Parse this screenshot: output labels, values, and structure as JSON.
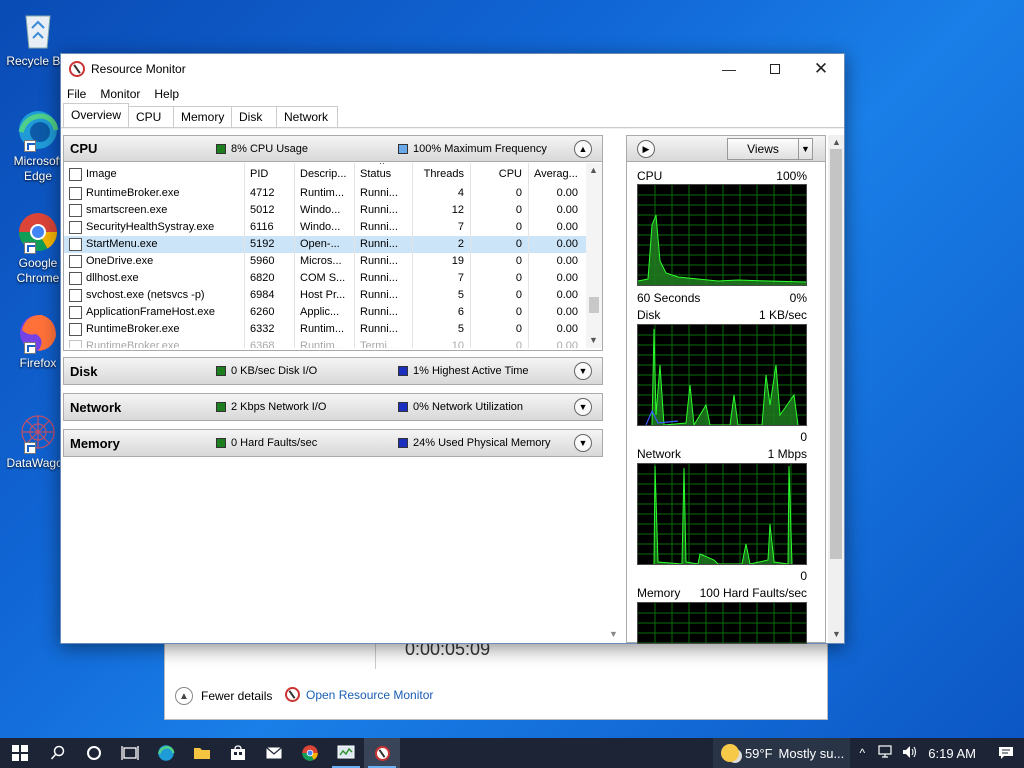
{
  "desktop": {
    "icons": [
      {
        "label": "Recycle Bin",
        "icon": "recycle-bin-icon"
      },
      {
        "label": "Microsoft Edge",
        "icon": "edge-icon"
      },
      {
        "label": "Google Chrome",
        "icon": "chrome-icon"
      },
      {
        "label": "Firefox",
        "icon": "firefox-icon"
      },
      {
        "label": "DataWagon",
        "icon": "datawagon-icon"
      }
    ]
  },
  "taskmgr": {
    "digits": "0:00:05:09",
    "fewer_details": "Fewer details",
    "open_resource_monitor": "Open Resource Monitor"
  },
  "window": {
    "title": "Resource Monitor",
    "menu": [
      "File",
      "Monitor",
      "Help"
    ],
    "tabs": [
      "Overview",
      "CPU",
      "Memory",
      "Disk",
      "Network"
    ],
    "active_tab": "Overview"
  },
  "cpu": {
    "title": "CPU",
    "usage": "8% CPU Usage",
    "frequency": "100% Maximum Frequency",
    "columns": [
      "Image",
      "PID",
      "Descrip...",
      "Status",
      "Threads",
      "CPU",
      "Averag..."
    ],
    "rows": [
      {
        "image": "RuntimeBroker.exe",
        "pid": "4712",
        "desc": "Runtim...",
        "status": "Runni...",
        "threads": "4",
        "cpu": "0",
        "avg": "0.00"
      },
      {
        "image": "smartscreen.exe",
        "pid": "5012",
        "desc": "Windo...",
        "status": "Runni...",
        "threads": "12",
        "cpu": "0",
        "avg": "0.00"
      },
      {
        "image": "SecurityHealthSystray.exe",
        "pid": "6116",
        "desc": "Windo...",
        "status": "Runni...",
        "threads": "7",
        "cpu": "0",
        "avg": "0.00"
      },
      {
        "image": "StartMenu.exe",
        "pid": "5192",
        "desc": "Open-...",
        "status": "Runni...",
        "threads": "2",
        "cpu": "0",
        "avg": "0.00"
      },
      {
        "image": "OneDrive.exe",
        "pid": "5960",
        "desc": "Micros...",
        "status": "Runni...",
        "threads": "19",
        "cpu": "0",
        "avg": "0.00"
      },
      {
        "image": "dllhost.exe",
        "pid": "6820",
        "desc": "COM S...",
        "status": "Runni...",
        "threads": "7",
        "cpu": "0",
        "avg": "0.00"
      },
      {
        "image": "svchost.exe (netsvcs -p)",
        "pid": "6984",
        "desc": "Host Pr...",
        "status": "Runni...",
        "threads": "5",
        "cpu": "0",
        "avg": "0.00"
      },
      {
        "image": "ApplicationFrameHost.exe",
        "pid": "6260",
        "desc": "Applic...",
        "status": "Runni...",
        "threads": "6",
        "cpu": "0",
        "avg": "0.00"
      },
      {
        "image": "RuntimeBroker.exe",
        "pid": "6332",
        "desc": "Runtim...",
        "status": "Runni...",
        "threads": "5",
        "cpu": "0",
        "avg": "0.00"
      },
      {
        "image": "RuntimeBroker.exe",
        "pid": "6368",
        "desc": "Runtim...",
        "status": "Termi...",
        "threads": "10",
        "cpu": "0",
        "avg": "0.00"
      }
    ],
    "selected_row": 3
  },
  "disk": {
    "title": "Disk",
    "io": "0 KB/sec Disk I/O",
    "active": "1% Highest Active Time"
  },
  "network": {
    "title": "Network",
    "io": "2 Kbps Network I/O",
    "util": "0% Network Utilization"
  },
  "memory": {
    "title": "Memory",
    "faults": "0 Hard Faults/sec",
    "used": "24% Used Physical Memory"
  },
  "graphs": {
    "views_label": "Views",
    "cpu": {
      "label": "CPU",
      "max": "100%",
      "time": "60 Seconds",
      "min": "0%"
    },
    "disk": {
      "label": "Disk",
      "max": "1 KB/sec",
      "min": "0"
    },
    "network": {
      "label": "Network",
      "max": "1 Mbps",
      "min": "0"
    },
    "memory": {
      "label": "Memory",
      "max": "100 Hard Faults/sec"
    }
  },
  "tray": {
    "temp": "59°F",
    "weather": "Mostly su...",
    "time": "6:19 AM"
  },
  "colors": {
    "green": "#1e7d1e",
    "blue": "#1a2fbf",
    "light_blue": "#6aa8e8",
    "graph_line": "#00ff00",
    "selection": "#cce4f7"
  }
}
